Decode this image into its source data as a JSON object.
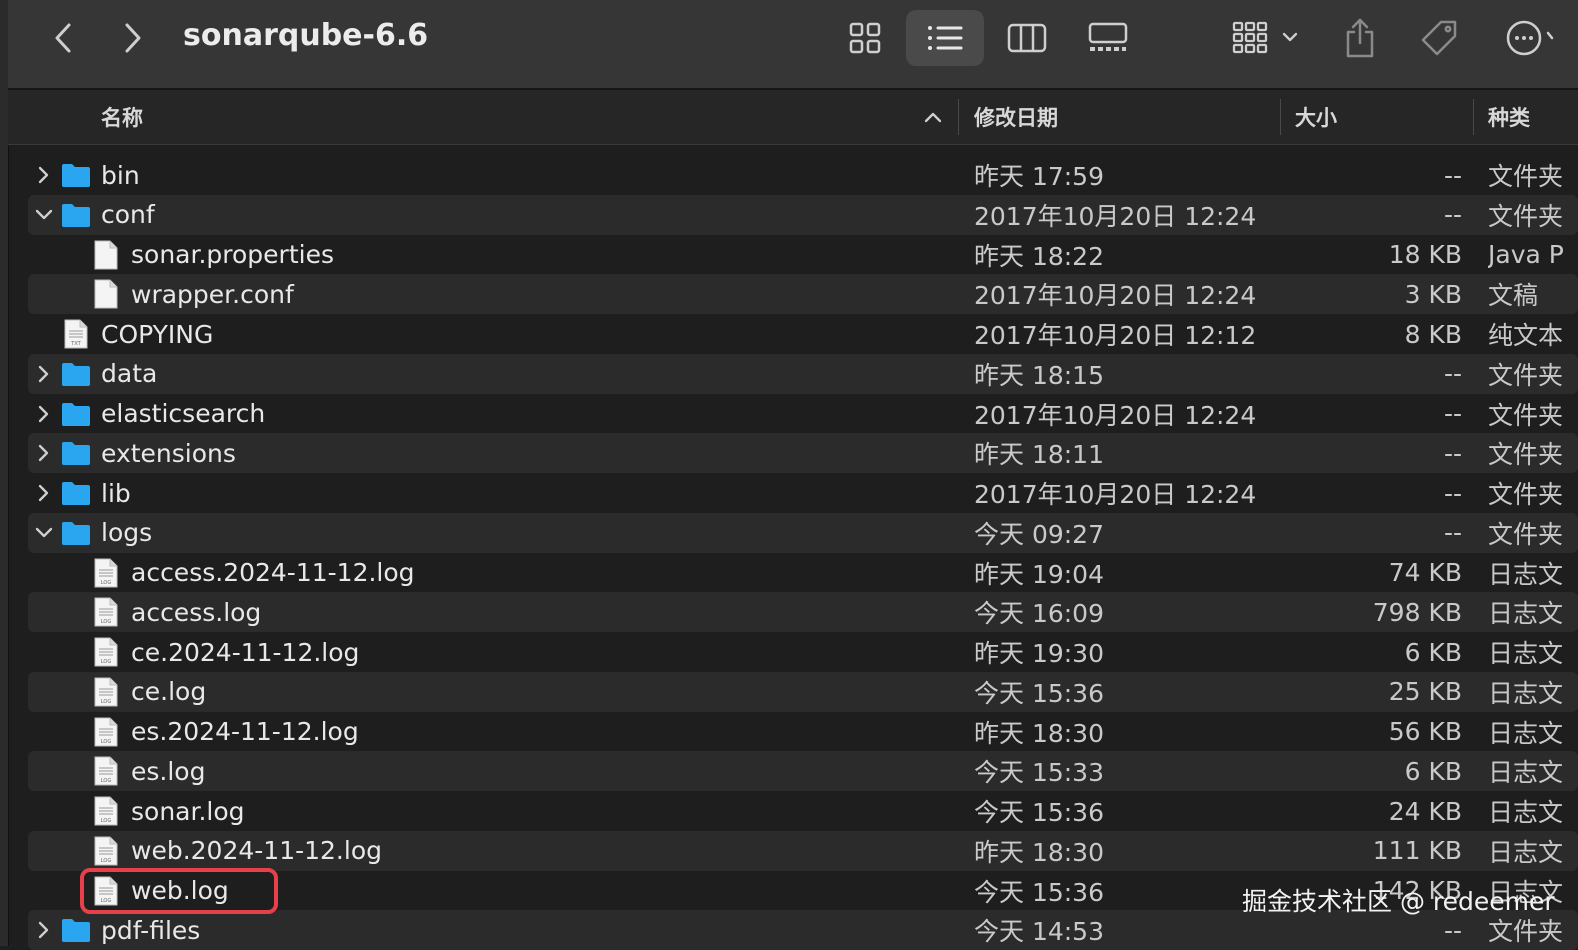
{
  "toolbar": {
    "title": "sonarqube-6.6",
    "icons": [
      "back-icon",
      "forward-icon",
      "icon-view-icon",
      "list-view-icon",
      "column-view-icon",
      "gallery-view-icon",
      "group-icon",
      "share-icon",
      "tag-icon",
      "more-icon"
    ]
  },
  "columns": {
    "name": "名称",
    "date": "修改日期",
    "size": "大小",
    "kind": "种类"
  },
  "rows": [
    {
      "name": "bin",
      "date": "昨天 17:59",
      "size": "--",
      "kind": "文件夹",
      "type": "folder",
      "depth": 0,
      "chevron": "right"
    },
    {
      "name": "conf",
      "date": "2017年10月20日 12:24",
      "size": "--",
      "kind": "文件夹",
      "type": "folder",
      "depth": 0,
      "chevron": "down"
    },
    {
      "name": "sonar.properties",
      "date": "昨天 18:22",
      "size": "18 KB",
      "kind": "Java P",
      "type": "file",
      "depth": 1,
      "chevron": ""
    },
    {
      "name": "wrapper.conf",
      "date": "2017年10月20日 12:24",
      "size": "3 KB",
      "kind": "文稿",
      "type": "file",
      "depth": 1,
      "chevron": ""
    },
    {
      "name": "COPYING",
      "date": "2017年10月20日 12:12",
      "size": "8 KB",
      "kind": "纯文本",
      "type": "txt",
      "depth": 0,
      "chevron": ""
    },
    {
      "name": "data",
      "date": "昨天 18:15",
      "size": "--",
      "kind": "文件夹",
      "type": "folder",
      "depth": 0,
      "chevron": "right"
    },
    {
      "name": "elasticsearch",
      "date": "2017年10月20日 12:24",
      "size": "--",
      "kind": "文件夹",
      "type": "folder",
      "depth": 0,
      "chevron": "right"
    },
    {
      "name": "extensions",
      "date": "昨天 18:11",
      "size": "--",
      "kind": "文件夹",
      "type": "folder",
      "depth": 0,
      "chevron": "right"
    },
    {
      "name": "lib",
      "date": "2017年10月20日 12:24",
      "size": "--",
      "kind": "文件夹",
      "type": "folder",
      "depth": 0,
      "chevron": "right"
    },
    {
      "name": "logs",
      "date": "今天 09:27",
      "size": "--",
      "kind": "文件夹",
      "type": "folder",
      "depth": 0,
      "chevron": "down"
    },
    {
      "name": "access.2024-11-12.log",
      "date": "昨天 19:04",
      "size": "74 KB",
      "kind": "日志文",
      "type": "log",
      "depth": 1,
      "chevron": ""
    },
    {
      "name": "access.log",
      "date": "今天 16:09",
      "size": "798 KB",
      "kind": "日志文",
      "type": "log",
      "depth": 1,
      "chevron": ""
    },
    {
      "name": "ce.2024-11-12.log",
      "date": "昨天 19:30",
      "size": "6 KB",
      "kind": "日志文",
      "type": "log",
      "depth": 1,
      "chevron": ""
    },
    {
      "name": "ce.log",
      "date": "今天 15:36",
      "size": "25 KB",
      "kind": "日志文",
      "type": "log",
      "depth": 1,
      "chevron": ""
    },
    {
      "name": "es.2024-11-12.log",
      "date": "昨天 18:30",
      "size": "56 KB",
      "kind": "日志文",
      "type": "log",
      "depth": 1,
      "chevron": ""
    },
    {
      "name": "es.log",
      "date": "今天 15:33",
      "size": "6 KB",
      "kind": "日志文",
      "type": "log",
      "depth": 1,
      "chevron": ""
    },
    {
      "name": "sonar.log",
      "date": "今天 15:36",
      "size": "24 KB",
      "kind": "日志文",
      "type": "log",
      "depth": 1,
      "chevron": ""
    },
    {
      "name": "web.2024-11-12.log",
      "date": "昨天 18:30",
      "size": "111 KB",
      "kind": "日志文",
      "type": "log",
      "depth": 1,
      "chevron": ""
    },
    {
      "name": "web.log",
      "date": "今天 15:36",
      "size": "142 KB",
      "kind": "日志文",
      "type": "log",
      "depth": 1,
      "chevron": ""
    },
    {
      "name": "pdf-files",
      "date": "今天 14:53",
      "size": "--",
      "kind": "文件夹",
      "type": "folder",
      "depth": 0,
      "chevron": "right"
    }
  ],
  "watermark": "掘金技术社区 @ redeemer",
  "colors": {
    "folder": "#2aa5f0",
    "highlight": "#e8404a",
    "background": "#1e1e1e"
  }
}
